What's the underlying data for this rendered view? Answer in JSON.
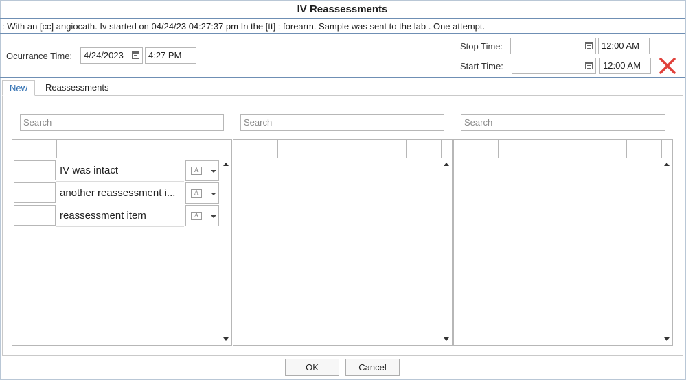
{
  "window": {
    "title": "IV Reassessments",
    "summary": ": With an [cc] angiocath. Iv started on 04/24/23 04:27:37 pm In the [tt] : forearm. Sample was sent to the lab . One attempt."
  },
  "occurrence": {
    "label": "Ocurrance Time:",
    "date": "4/24/2023",
    "time": "4:27 PM"
  },
  "stop": {
    "label": "Stop Time:",
    "date": "",
    "time": "12:00 AM"
  },
  "start": {
    "label": "Start Time:",
    "date": "",
    "time": "12:00 AM"
  },
  "delete_icon": {
    "name": "close-icon",
    "color": "#e0403a"
  },
  "tabs": [
    {
      "label": "New",
      "active": true
    },
    {
      "label": "Reassessments",
      "active": false
    }
  ],
  "search": {
    "placeholder": "Search"
  },
  "items": [
    {
      "label": "IV was intact",
      "checked": false
    },
    {
      "label": "another reassessment i...",
      "checked": false
    },
    {
      "label": "reassessment item",
      "checked": false
    }
  ],
  "buttons": {
    "ok": "OK",
    "cancel": "Cancel"
  },
  "colors": {
    "accent": "#2b6cb0",
    "rule": "#6f8fb4"
  }
}
